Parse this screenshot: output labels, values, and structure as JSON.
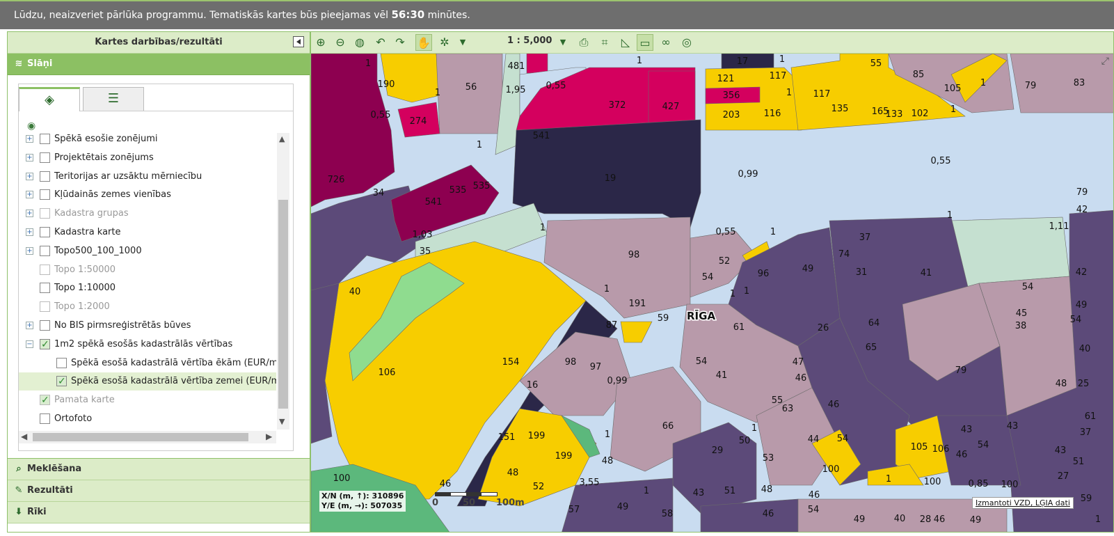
{
  "banner": {
    "text_before": "Lūdzu, neaizveriet pārlūka programmu. Tematiskās kartes būs pieejamas vēl ",
    "countdown": "56:30",
    "text_after": " minūtes."
  },
  "left_panel": {
    "title": "Kartes darbības/rezultāti",
    "layers_section": "Slāņi",
    "search_section": "Meklēšana",
    "results_section": "Rezultāti",
    "tools_section": "Rīki",
    "layers": [
      {
        "label": "Spēkā esošie zonējumi",
        "expander": "+",
        "checked": false,
        "dim": false,
        "indent": 0
      },
      {
        "label": "Projektētais zonējums",
        "expander": "+",
        "checked": false,
        "dim": false,
        "indent": 0
      },
      {
        "label": "Teritorijas ar uzsāktu mērniecību",
        "expander": "+",
        "checked": false,
        "dim": false,
        "indent": 0
      },
      {
        "label": "Kļūdainās zemes vienības",
        "expander": "+",
        "checked": false,
        "dim": false,
        "indent": 0
      },
      {
        "label": "Kadastra grupas",
        "expander": "+",
        "checked": false,
        "dim": true,
        "indent": 0
      },
      {
        "label": "Kadastra karte",
        "expander": "+",
        "checked": false,
        "dim": false,
        "indent": 0
      },
      {
        "label": "Topo500_100_1000",
        "expander": "+",
        "checked": false,
        "dim": false,
        "indent": 0
      },
      {
        "label": "Topo 1:50000",
        "expander": "",
        "checked": false,
        "dim": true,
        "indent": 0
      },
      {
        "label": "Topo 1:10000",
        "expander": "",
        "checked": false,
        "dim": false,
        "indent": 0
      },
      {
        "label": "Topo 1:2000",
        "expander": "",
        "checked": false,
        "dim": true,
        "indent": 0
      },
      {
        "label": "No BIS pirmsreģistrētās būves",
        "expander": "+",
        "checked": false,
        "dim": false,
        "indent": 0
      },
      {
        "label": "1m2 spēkā esošās kadastrālās vērtības",
        "expander": "−",
        "checked": true,
        "dim": false,
        "indent": 0
      },
      {
        "label": "Spēkā esošā kadastrālā vērtība ēkām (EUR/m2",
        "expander": "",
        "checked": false,
        "dim": false,
        "indent": 1
      },
      {
        "label": "Spēkā esošā kadastrālā vērtība zemei (EUR/m",
        "expander": "",
        "checked": true,
        "dim": false,
        "indent": 1,
        "selected": true
      },
      {
        "label": "Pamata karte",
        "expander": "",
        "checked": true,
        "dim": true,
        "indent": 0
      },
      {
        "label": "Ortofoto",
        "expander": "",
        "checked": false,
        "dim": false,
        "indent": 0
      }
    ]
  },
  "map": {
    "scale": "1 : 5,000",
    "city_label": "RĪGA",
    "coord_xn": "X/N (m, ↑): 310896",
    "coord_ye": "Y/E (m, →): 507035",
    "scalebar_labels": [
      "0",
      "50",
      "100m"
    ],
    "attribution": "Izmantoti VZD, LĢIA dati",
    "colors": {
      "road": "#c9dcf0",
      "yellow": "#f7cd00",
      "magenta": "#d4005e",
      "dark_magenta": "#8d0050",
      "navy": "#2b2748",
      "purple": "#5c4a79",
      "mauve": "#b89aaa",
      "light_green": "#c5e0d0",
      "green": "#5cb87c"
    },
    "parcel_labels": [
      {
        "t": "1"
      },
      {
        "t": "481"
      },
      {
        "t": "1"
      },
      {
        "t": "17"
      },
      {
        "t": "1"
      },
      {
        "t": "55"
      },
      {
        "t": "85"
      },
      {
        "t": "1"
      },
      {
        "t": "83"
      },
      {
        "t": "190"
      },
      {
        "t": "56"
      },
      {
        "t": "1,95"
      },
      {
        "t": "0,55"
      },
      {
        "t": "372"
      },
      {
        "t": "427"
      },
      {
        "t": "121"
      },
      {
        "t": "117"
      },
      {
        "t": "105"
      },
      {
        "t": "79"
      },
      {
        "t": "1"
      },
      {
        "t": "356"
      },
      {
        "t": "1"
      },
      {
        "t": "117"
      },
      {
        "t": "0,55"
      },
      {
        "t": "274"
      },
      {
        "t": "203"
      },
      {
        "t": "116"
      },
      {
        "t": "135"
      },
      {
        "t": "165"
      },
      {
        "t": "133"
      },
      {
        "t": "102"
      },
      {
        "t": "1"
      },
      {
        "t": "541"
      },
      {
        "t": "1"
      },
      {
        "t": "19"
      },
      {
        "t": "0,99"
      },
      {
        "t": "0,55"
      },
      {
        "t": "726"
      },
      {
        "t": "535"
      },
      {
        "t": "535"
      },
      {
        "t": "34"
      },
      {
        "t": "79"
      },
      {
        "t": "541"
      },
      {
        "t": "42"
      },
      {
        "t": "1"
      },
      {
        "t": "1"
      },
      {
        "t": "1,11"
      },
      {
        "t": "1,03"
      },
      {
        "t": "0,55"
      },
      {
        "t": "37"
      },
      {
        "t": "1"
      },
      {
        "t": "35"
      },
      {
        "t": "74"
      },
      {
        "t": "98"
      },
      {
        "t": "52"
      },
      {
        "t": "49"
      },
      {
        "t": "31"
      },
      {
        "t": "41"
      },
      {
        "t": "42"
      },
      {
        "t": "40"
      },
      {
        "t": "1"
      },
      {
        "t": "54"
      },
      {
        "t": "96"
      },
      {
        "t": "54"
      },
      {
        "t": "1"
      },
      {
        "t": "191"
      },
      {
        "t": "1"
      },
      {
        "t": "45"
      },
      {
        "t": "49"
      },
      {
        "t": "59"
      },
      {
        "t": "64"
      },
      {
        "t": "38"
      },
      {
        "t": "87"
      },
      {
        "t": "61"
      },
      {
        "t": "26"
      },
      {
        "t": "54"
      },
      {
        "t": "40"
      },
      {
        "t": "65"
      },
      {
        "t": "106"
      },
      {
        "t": "154"
      },
      {
        "t": "98"
      },
      {
        "t": "97"
      },
      {
        "t": "54"
      },
      {
        "t": "41"
      },
      {
        "t": "47"
      },
      {
        "t": "79"
      },
      {
        "t": "48"
      },
      {
        "t": "16"
      },
      {
        "t": "0,99"
      },
      {
        "t": "46"
      },
      {
        "t": "25"
      },
      {
        "t": "55"
      },
      {
        "t": "46"
      },
      {
        "t": "63"
      },
      {
        "t": "61"
      },
      {
        "t": "66"
      },
      {
        "t": "1"
      },
      {
        "t": "44"
      },
      {
        "t": "54"
      },
      {
        "t": "43"
      },
      {
        "t": "43"
      },
      {
        "t": "37"
      },
      {
        "t": "151"
      },
      {
        "t": "199"
      },
      {
        "t": "199"
      },
      {
        "t": "1"
      },
      {
        "t": "29"
      },
      {
        "t": "50"
      },
      {
        "t": "53"
      },
      {
        "t": "48"
      },
      {
        "t": "105"
      },
      {
        "t": "106"
      },
      {
        "t": "46"
      },
      {
        "t": "54"
      },
      {
        "t": "43"
      },
      {
        "t": "51"
      },
      {
        "t": "48"
      },
      {
        "t": "100"
      },
      {
        "t": "52"
      },
      {
        "t": "100"
      },
      {
        "t": "3,55"
      },
      {
        "t": "46"
      },
      {
        "t": "1"
      },
      {
        "t": "100"
      },
      {
        "t": "0,85"
      },
      {
        "t": "27"
      },
      {
        "t": "100"
      },
      {
        "t": "1"
      },
      {
        "t": "43"
      },
      {
        "t": "51"
      },
      {
        "t": "48"
      },
      {
        "t": "46"
      },
      {
        "t": "59"
      },
      {
        "t": "57"
      },
      {
        "t": "49"
      },
      {
        "t": "58"
      },
      {
        "t": "46"
      },
      {
        "t": "54"
      },
      {
        "t": "49"
      },
      {
        "t": "40"
      },
      {
        "t": "28"
      },
      {
        "t": "49"
      },
      {
        "t": "46"
      },
      {
        "t": "1"
      },
      {
        "t": "37"
      }
    ]
  }
}
